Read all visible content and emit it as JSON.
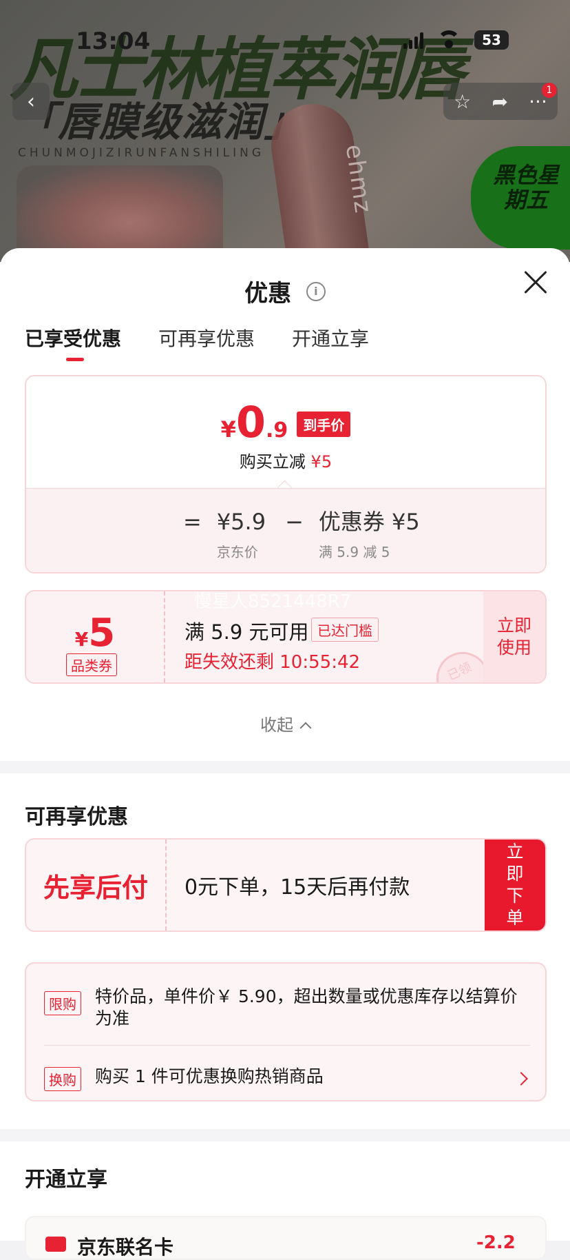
{
  "status_bar": {
    "time": "13:04",
    "battery": "53"
  },
  "product_bg": {
    "title": "凡士林植萃润唇",
    "subtitle": "「唇膜级滋润」",
    "pinyin": "CHUNMOJIZIRUNFANSHILING",
    "tube_text": "ehmz",
    "promo_badge": "黑色星期五"
  },
  "nav": {
    "back_icon": "chevron-left-icon",
    "badge_count": "1"
  },
  "sheet": {
    "title": "优惠",
    "tabs": [
      {
        "label": "已享受优惠",
        "active": true
      },
      {
        "label": "可再享优惠",
        "active": false
      },
      {
        "label": "开通立享",
        "active": false
      }
    ]
  },
  "price_card": {
    "yen": "¥",
    "price_int": "0",
    "price_dec": ".9",
    "price_tag": "到手价",
    "reduce_label": "购买立减",
    "reduce_amount": "¥5",
    "eq": "=",
    "minus": "−",
    "jd_value": "¥5.9",
    "jd_label": "京东价",
    "coupon_value": "优惠券 ¥5",
    "coupon_label": "满 5.9 减 5"
  },
  "coupon": {
    "yen": "¥",
    "amount": "5",
    "type": "品类券",
    "watermark": "慢星人8521448R7",
    "condition": "满 5.9 元可用",
    "threshold_badge": "已达门槛",
    "countdown": "距失效还剩 10:55:42",
    "stamp": "已领",
    "button": "立即使用"
  },
  "collapse_label": "收起",
  "more": {
    "title": "可再享优惠",
    "bnpl_title": "先享后付",
    "bnpl_text": "0元下单，15天后再付款",
    "bnpl_button": "立即下单",
    "rules": [
      {
        "tag": "限购",
        "text": "特价品，单件价￥ 5.90，超出数量或优惠库存以结算价为准"
      },
      {
        "tag": "换购",
        "text": "购买 1 件可优惠换购热销商品"
      }
    ]
  },
  "open": {
    "title": "开通立享",
    "member_text": "京东联名卡",
    "member_right": "-2.2"
  },
  "colors": {
    "accent": "#e62233",
    "card_border": "#f6d4d8",
    "card_bg": "#fcf4f5"
  }
}
